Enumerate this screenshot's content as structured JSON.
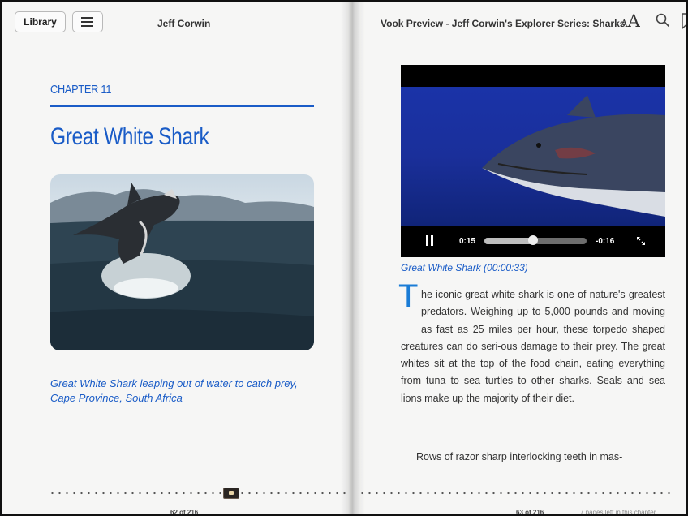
{
  "toolbar": {
    "library_label": "Library",
    "author": "Jeff Corwin",
    "title": "Vook Preview - Jeff Corwin's Explorer Series: Sharks",
    "font_small": "A",
    "font_big": "A"
  },
  "left_page": {
    "chapter_label": "CHAPTER 11",
    "chapter_title": "Great White Shark",
    "photo_caption": "Great White Shark leaping out of water to catch prey, Cape Province, South Africa",
    "page_number": "62 of 216"
  },
  "right_page": {
    "video": {
      "elapsed": "0:15",
      "remaining": "-0:16",
      "progress": 0.48
    },
    "video_caption": "Great White Shark (00:00:33)",
    "dropcap": "T",
    "paragraph1": "he iconic great white shark is one of nature's greatest predators. Weighing up to 5,000 pounds and moving as fast as 25 miles per hour, these torpedo shaped creatures can do seri-ous damage to their prey. The great whites sit at the top of the food chain, eating everything from tuna to sea turtles to other sharks. Seals and sea lions make up the majority of their diet.",
    "paragraph2_start": "Rows of razor sharp interlocking teeth in mas-",
    "page_number": "63 of 216",
    "pages_left": "7 pages left in this chapter"
  },
  "colors": {
    "accent": "#1a5cc7",
    "dropcap": "#1a7cd6"
  }
}
